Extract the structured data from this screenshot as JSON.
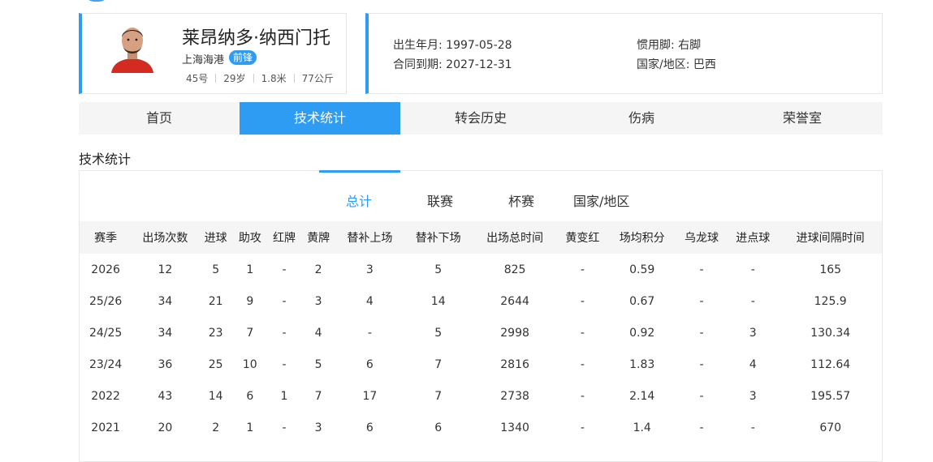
{
  "player": {
    "name": "莱昂纳多·纳西门托",
    "team": "上海海港",
    "position": "前锋",
    "number": "45号",
    "age": "29岁",
    "height": "1.8米",
    "weight": "77公斤"
  },
  "info": {
    "birth": "出生年月: 1997-05-28",
    "contract": "合同到期: 2027-12-31",
    "foot": "惯用脚: 右脚",
    "nation": "国家/地区: 巴西"
  },
  "tabs": [
    "首页",
    "技术统计",
    "转会历史",
    "伤病",
    "荣誉室"
  ],
  "section_title": "技术统计",
  "sub_tabs": [
    "总计",
    "联赛",
    "杯赛",
    "国家/地区"
  ],
  "table": {
    "headers": [
      "赛季",
      "出场次数",
      "进球",
      "助攻",
      "红牌",
      "黄牌",
      "替补上场",
      "替补下场",
      "出场总时间",
      "黄变红",
      "场均积分",
      "乌龙球",
      "进点球",
      "进球间隔时间"
    ],
    "rows": [
      [
        "2026",
        "12",
        "5",
        "1",
        "-",
        "2",
        "3",
        "5",
        "825",
        "-",
        "0.59",
        "-",
        "-",
        "165"
      ],
      [
        "25/26",
        "34",
        "21",
        "9",
        "-",
        "3",
        "4",
        "14",
        "2644",
        "-",
        "0.67",
        "-",
        "-",
        "125.9"
      ],
      [
        "24/25",
        "34",
        "23",
        "7",
        "-",
        "4",
        "-",
        "5",
        "2998",
        "-",
        "0.92",
        "-",
        "3",
        "130.34"
      ],
      [
        "23/24",
        "36",
        "25",
        "10",
        "-",
        "5",
        "6",
        "7",
        "2816",
        "-",
        "1.83",
        "-",
        "4",
        "112.64"
      ],
      [
        "2022",
        "43",
        "14",
        "6",
        "1",
        "7",
        "17",
        "7",
        "2738",
        "-",
        "2.14",
        "-",
        "3",
        "195.57"
      ],
      [
        "2021",
        "20",
        "2",
        "1",
        "-",
        "3",
        "6",
        "6",
        "1340",
        "-",
        "1.4",
        "-",
        "-",
        "670"
      ]
    ]
  },
  "colors": {
    "accent": "#2e9cf3",
    "tab_bg": "#f5f5f5"
  },
  "icons": {
    "avatar": "player-avatar"
  }
}
